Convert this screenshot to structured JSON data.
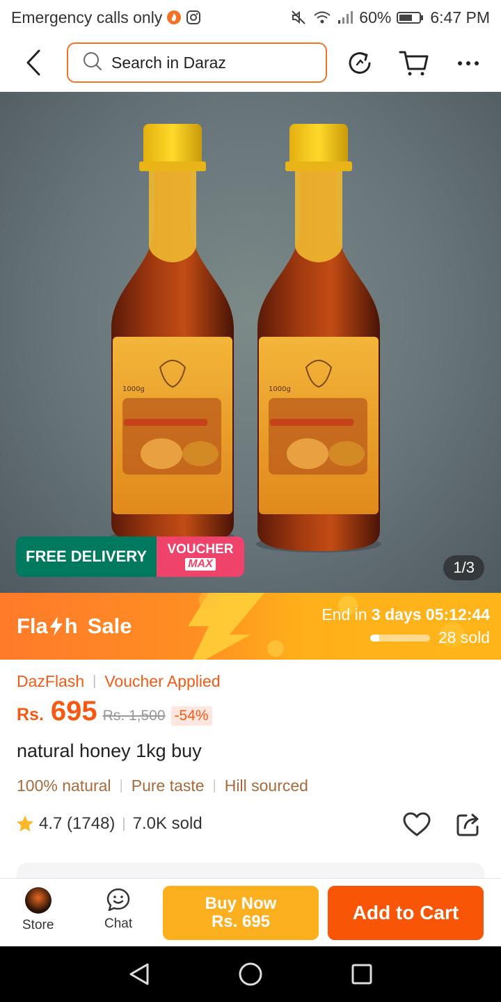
{
  "status": {
    "left_text": "Emergency calls only",
    "battery": "60%",
    "time": "6:47 PM"
  },
  "header": {
    "search_placeholder": "Search in Daraz"
  },
  "gallery": {
    "badge_free_delivery": "FREE DELIVERY",
    "badge_voucher": "VOUCHER",
    "badge_voucher_max": "MAX",
    "counter": "1/3",
    "image": {
      "bottle_weight": "1000g"
    }
  },
  "flash": {
    "title_prefix": "Fla",
    "title_suffix": "h",
    "title_word2": "Sale",
    "end_prefix": "End in",
    "end_days": "3 days",
    "end_time": "05:12:44",
    "sold": "28 sold",
    "progress": 0.15
  },
  "product": {
    "tag1": "DazFlash",
    "tag2": "Voucher Applied",
    "currency": "Rs.",
    "price": "695",
    "old_price": "Rs. 1,500",
    "discount": "-54%",
    "title": "natural honey 1kg buy",
    "features": [
      "100% natural",
      "Pure taste",
      "Hill sourced"
    ],
    "rating": "4.7 (1748)",
    "sold": "7.0K sold"
  },
  "bottom": {
    "store_label": "Store",
    "chat_label": "Chat",
    "buy_now_label": "Buy Now",
    "buy_now_price": "Rs. 695",
    "add_cart_label": "Add to Cart"
  },
  "colors": {
    "accent": "#f85606",
    "buy_now": "#fdb01f",
    "free_delivery": "#007a5e",
    "voucher": "#f0436b"
  }
}
